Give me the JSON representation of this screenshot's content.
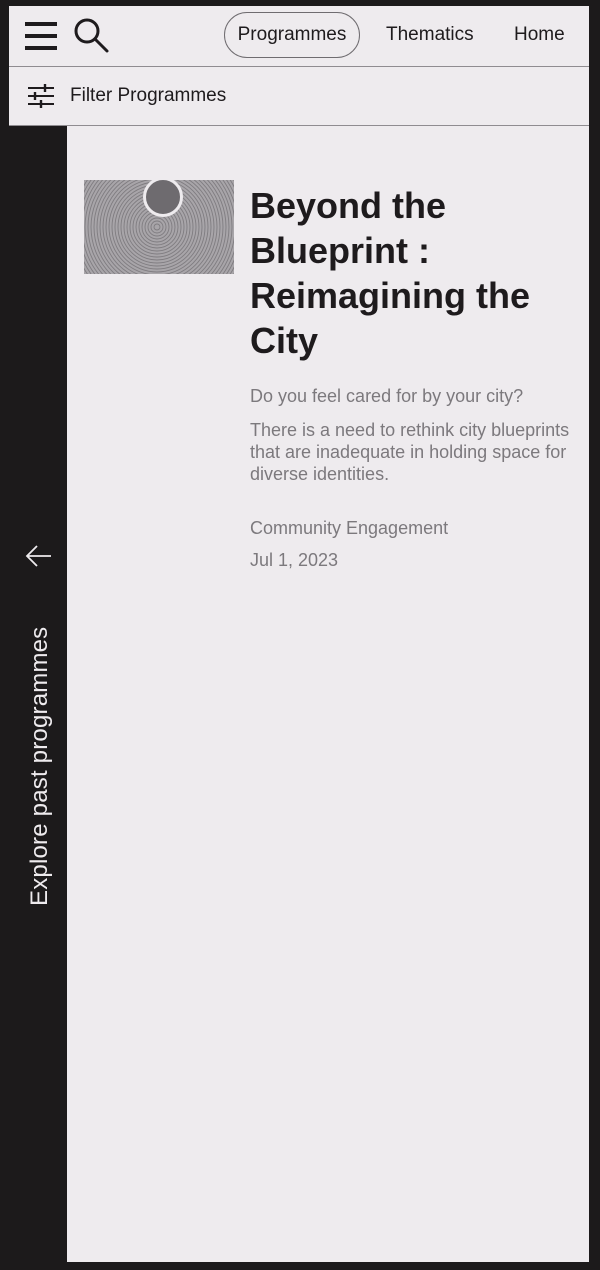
{
  "header": {
    "menu_icon": "hamburger-menu-icon",
    "search_icon": "search-icon",
    "nav": {
      "programmes": "Programmes",
      "thematics": "Thematics",
      "home": "Home"
    }
  },
  "filter": {
    "icon": "sliders-icon",
    "label": "Filter Programmes"
  },
  "sidebar": {
    "icon": "arrow-left-icon",
    "label": "Explore past programmes"
  },
  "programme": {
    "title": "Beyond the Blueprint : Reimagining the City",
    "lead": "Do you feel cared for by your city?",
    "description": "There is a need to rethink city blueprints that are inadequate in holding space for diverse identities.",
    "category": "Community Engagement",
    "date": "Jul 1, 2023"
  },
  "colors": {
    "page_background": "#eeebee",
    "dark": "#1c1a1b",
    "text": "#1e1b1d",
    "muted_text": "#7c797d"
  }
}
